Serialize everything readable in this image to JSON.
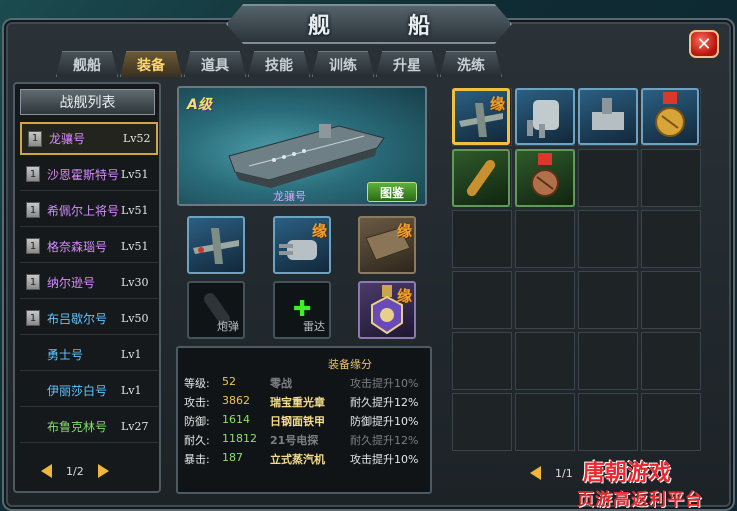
{
  "title": "舰　船",
  "close_label": "✕",
  "tabs": [
    {
      "label": "舰船"
    },
    {
      "label": "装备"
    },
    {
      "label": "道具"
    },
    {
      "label": "技能"
    },
    {
      "label": "训练"
    },
    {
      "label": "升星"
    },
    {
      "label": "洗练"
    }
  ],
  "fleet_list": {
    "header": "战舰列表",
    "ships": [
      {
        "num": "1",
        "name": "龙骧号",
        "level": "Lv52",
        "color": "#d58cff"
      },
      {
        "num": "1",
        "name": "沙恩霍斯特号",
        "level": "Lv51",
        "color": "#d58cff"
      },
      {
        "num": "1",
        "name": "希佩尔上将号",
        "level": "Lv51",
        "color": "#d58cff"
      },
      {
        "num": "1",
        "name": "格奈森瑙号",
        "level": "Lv51",
        "color": "#d58cff"
      },
      {
        "num": "1",
        "name": "纳尔逊号",
        "level": "Lv30",
        "color": "#d58cff"
      },
      {
        "num": "1",
        "name": "布吕歇尔号",
        "level": "Lv50",
        "color": "#5fc6ff"
      },
      {
        "num": "",
        "name": "勇士号",
        "level": "Lv1",
        "color": "#5fc6ff"
      },
      {
        "num": "",
        "name": "伊丽莎白号",
        "level": "Lv1",
        "color": "#5fc6ff"
      },
      {
        "num": "",
        "name": "布鲁克林号",
        "level": "Lv27",
        "color": "#7ee06a"
      }
    ],
    "page": "1/2"
  },
  "preview": {
    "grade": "A级",
    "ship_name": "龙骧号",
    "tujian_button": "图鉴"
  },
  "equip_slots": {
    "yuan": "缘",
    "shell_label": "炮弹",
    "radar_label": "雷达"
  },
  "stats": {
    "rows": [
      {
        "label": "等级:",
        "value": "52",
        "color": "#f0c45a"
      },
      {
        "label": "攻击:",
        "value": "3862",
        "color": "#f0c45a"
      },
      {
        "label": "防御:",
        "value": "1614",
        "color": "#8fe06a"
      },
      {
        "label": "耐久:",
        "value": "11812",
        "color": "#8fe06a"
      },
      {
        "label": "暴击:",
        "value": "187",
        "color": "#8fe06a"
      }
    ],
    "set_title": "装备缘分",
    "set_rows": [
      {
        "name": "零战",
        "effect": "攻击提升10%",
        "active": false
      },
      {
        "name": "瑞宝重光章",
        "effect": "耐久提升12%",
        "active": true
      },
      {
        "name": "日钢面铁甲",
        "effect": "防御提升10%",
        "active": true
      },
      {
        "name": "21号电探",
        "effect": "耐久提升12%",
        "active": false
      },
      {
        "name": "立式蒸汽机",
        "effect": "攻击提升10%",
        "active": true
      }
    ]
  },
  "inventory": {
    "page": "1/1"
  },
  "brand": {
    "logo": "唐朝游戏",
    "slogan": "页游高返利平台"
  }
}
